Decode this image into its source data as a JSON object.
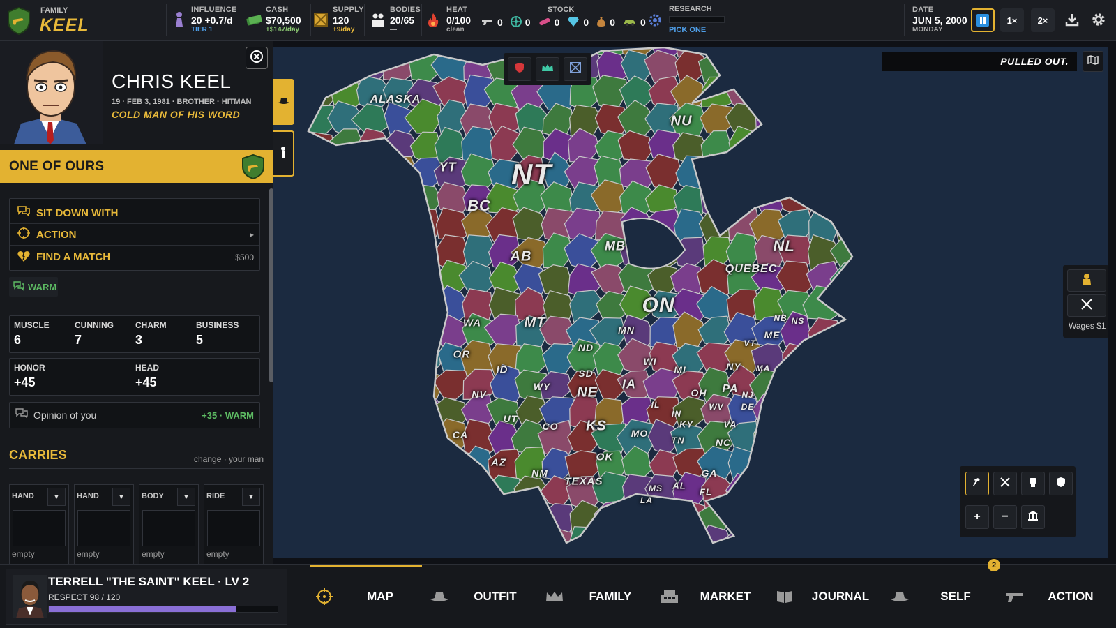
{
  "topbar": {
    "family_label": "FAMILY",
    "family_name": "KEEL",
    "influence": {
      "label": "INFLUENCE",
      "value": "20",
      "rate": "+0.7/d",
      "sub": "TIER 1"
    },
    "cash": {
      "label": "CASH",
      "value": "$70,500",
      "sub": "+$147/day"
    },
    "supply": {
      "label": "SUPPLY",
      "value": "120",
      "sub": "+9/day"
    },
    "bodies": {
      "label": "BODIES",
      "value": "20/65",
      "sub": "—"
    },
    "heat": {
      "label": "HEAT",
      "value": "0/100",
      "sub": "clean"
    },
    "stock": {
      "label": "STOCK",
      "items": [
        {
          "icon": "pistol-icon",
          "value": "0"
        },
        {
          "icon": "wheel-icon",
          "value": "0"
        },
        {
          "icon": "pill-icon",
          "value": "0"
        },
        {
          "icon": "diamond-icon",
          "value": "0"
        },
        {
          "icon": "sack-icon",
          "value": "0"
        },
        {
          "icon": "car-icon",
          "value": "0"
        }
      ]
    },
    "research": {
      "label": "RESEARCH",
      "sub": "PICK ONE"
    },
    "date": {
      "label": "DATE",
      "value": "JUN 5, 2000",
      "sub": "MONDAY"
    },
    "speed1": "1×",
    "speed2": "2×"
  },
  "character": {
    "name": "CHRIS KEEL",
    "meta": "19 · FEB 3, 1981 · BROTHER · HITMAN",
    "motto": "COLD MAN OF HIS WORD",
    "banner": "ONE OF OURS",
    "actions": [
      {
        "label": "SIT DOWN WITH",
        "icon": "chat-icon",
        "right": ""
      },
      {
        "label": "ACTION",
        "icon": "crosshair-icon",
        "right": "▸"
      },
      {
        "label": "FIND A MATCH",
        "icon": "heart-icon",
        "right": "$500"
      }
    ],
    "mood": "WARM",
    "attributes": [
      {
        "label": "MUSCLE",
        "value": "6"
      },
      {
        "label": "CUNNING",
        "value": "7"
      },
      {
        "label": "CHARM",
        "value": "3"
      },
      {
        "label": "BUSINESS",
        "value": "5"
      }
    ],
    "honor": {
      "label": "HONOR",
      "value": "+45"
    },
    "head": {
      "label": "HEAD",
      "value": "+45"
    },
    "opinion": {
      "label": "Opinion of you",
      "value": "+35",
      "sep": "·",
      "mood": "WARM"
    },
    "carries": {
      "title": "CARRIES",
      "links": "change · your man",
      "slots": [
        {
          "label": "HAND",
          "value": "empty"
        },
        {
          "label": "HAND",
          "value": "empty"
        },
        {
          "label": "BODY",
          "value": "empty"
        },
        {
          "label": "RIDE",
          "value": "empty"
        }
      ]
    }
  },
  "leader": {
    "name": "TERRELL \"THE SAINT\" KEEL · LV 2",
    "respect": "RESPECT 98 / 120",
    "respect_fraction": 0.817
  },
  "nav": {
    "badge": "2",
    "items": [
      {
        "label": "MAP",
        "icon": "crosshair-icon"
      },
      {
        "label": "OUTFIT",
        "icon": "hat-icon"
      },
      {
        "label": "FAMILY",
        "icon": "crown-icon"
      },
      {
        "label": "MARKET",
        "icon": "register-icon"
      },
      {
        "label": "JOURNAL",
        "icon": "book-icon"
      },
      {
        "label": "SELF",
        "icon": "hat-icon"
      },
      {
        "label": "ACTION",
        "icon": "pistol-icon"
      }
    ]
  },
  "map": {
    "status": "PULLED OUT.",
    "wages": "Wages $1",
    "labels": [
      {
        "text": "ALASKA"
      },
      {
        "text": "YT"
      },
      {
        "text": "NT"
      },
      {
        "text": "NU"
      },
      {
        "text": "BC"
      },
      {
        "text": "AB"
      },
      {
        "text": "MB"
      },
      {
        "text": "ON"
      },
      {
        "text": "QUEBEC"
      },
      {
        "text": "NL"
      },
      {
        "text": "WA"
      },
      {
        "text": "MT"
      },
      {
        "text": "ND"
      },
      {
        "text": "MN"
      },
      {
        "text": "OR"
      },
      {
        "text": "ID"
      },
      {
        "text": "SD"
      },
      {
        "text": "WY"
      },
      {
        "text": "WI"
      },
      {
        "text": "MI"
      },
      {
        "text": "NY"
      },
      {
        "text": "VT"
      },
      {
        "text": "ME"
      },
      {
        "text": "NB"
      },
      {
        "text": "NS"
      },
      {
        "text": "MA"
      },
      {
        "text": "IA"
      },
      {
        "text": "NE"
      },
      {
        "text": "NV"
      },
      {
        "text": "PA"
      },
      {
        "text": "NJ"
      },
      {
        "text": "OH"
      },
      {
        "text": "DE"
      },
      {
        "text": "WV"
      },
      {
        "text": "IL"
      },
      {
        "text": "IN"
      },
      {
        "text": "UT"
      },
      {
        "text": "CO"
      },
      {
        "text": "KS"
      },
      {
        "text": "MO"
      },
      {
        "text": "KY"
      },
      {
        "text": "VA"
      },
      {
        "text": "CA"
      },
      {
        "text": "TN"
      },
      {
        "text": "NC"
      },
      {
        "text": "OK"
      },
      {
        "text": "AZ"
      },
      {
        "text": "NM"
      },
      {
        "text": "TEXAS"
      },
      {
        "text": "GA"
      },
      {
        "text": "MS"
      },
      {
        "text": "AL"
      },
      {
        "text": "LA"
      },
      {
        "text": "FL"
      }
    ]
  }
}
